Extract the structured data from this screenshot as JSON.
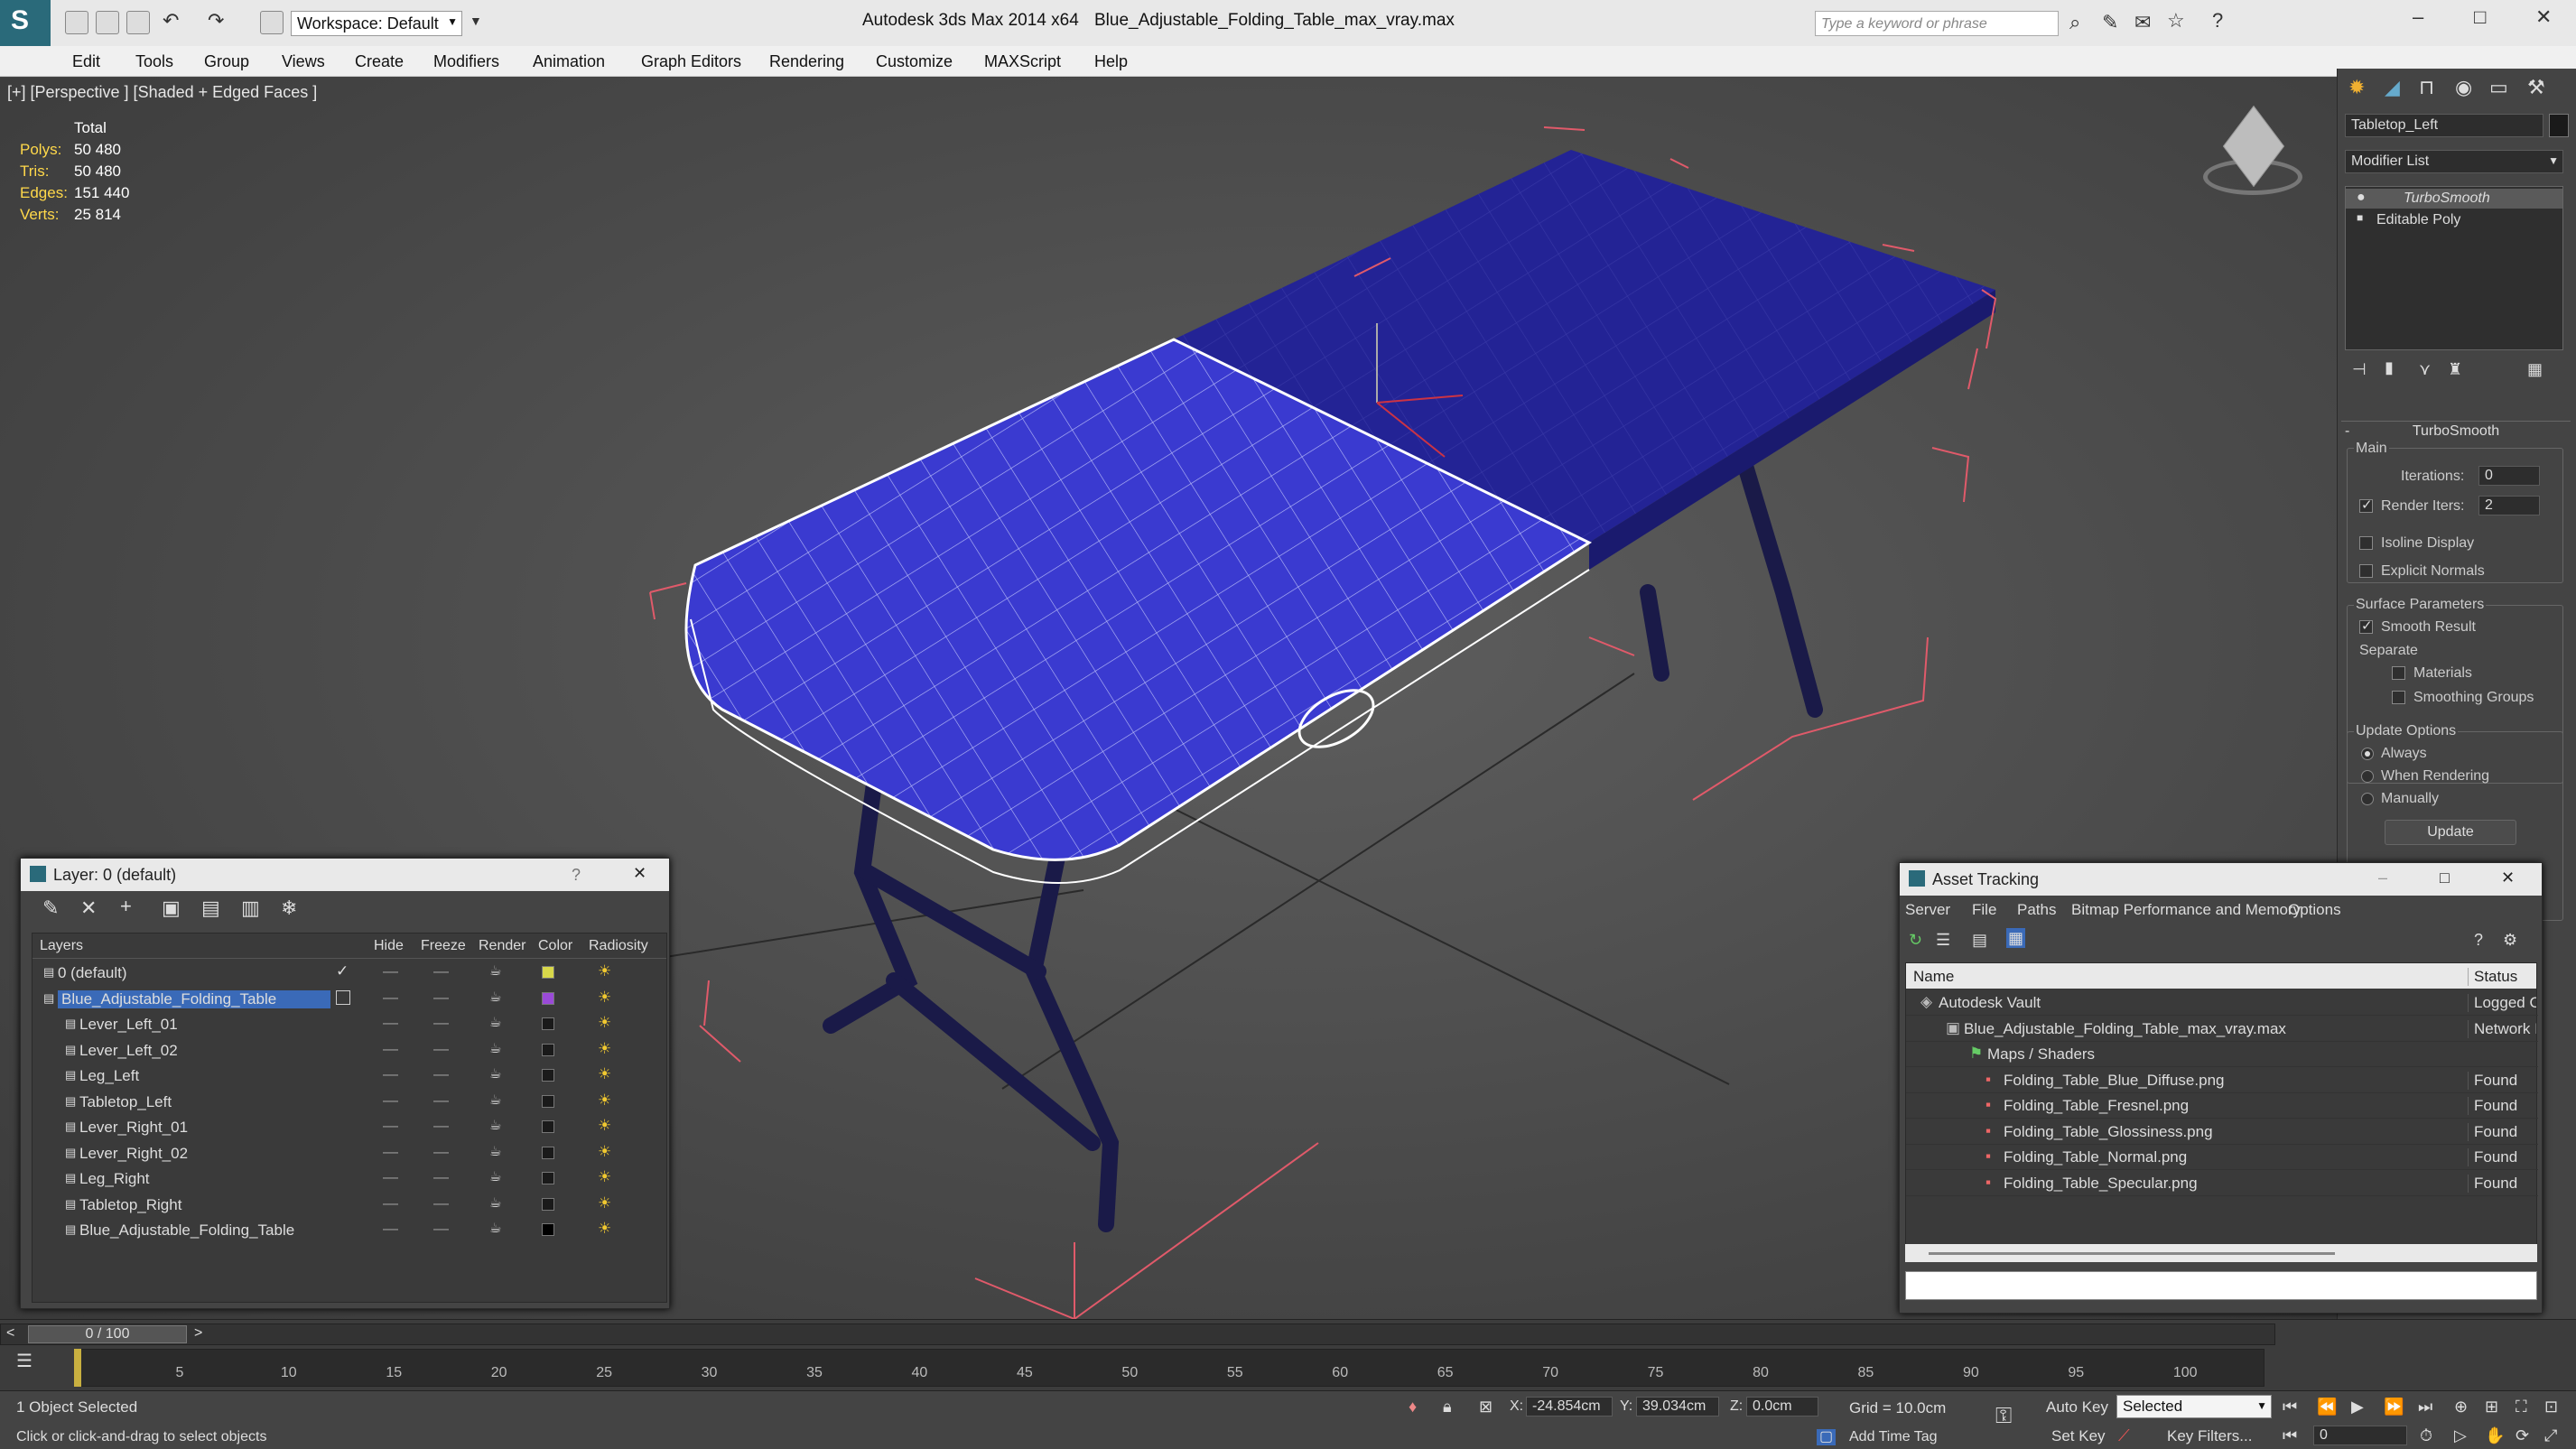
{
  "titlebar": {
    "app": "Autodesk 3ds Max  2014 x64",
    "file": "Blue_Adjustable_Folding_Table_max_vray.max",
    "workspace": "Workspace: Default",
    "search_placeholder": "Type a keyword or phrase"
  },
  "menu": [
    "Edit",
    "Tools",
    "Group",
    "Views",
    "Create",
    "Modifiers",
    "Animation",
    "Graph Editors",
    "Rendering",
    "Customize",
    "MAXScript",
    "Help"
  ],
  "viewport": {
    "label": "[+] [Perspective ] [Shaded + Edged Faces ]",
    "stats": {
      "total_label": "Total",
      "polys_label": "Polys:",
      "polys": "50 480",
      "tris_label": "Tris:",
      "tris": "50 480",
      "edges_label": "Edges:",
      "edges": "151 440",
      "verts_label": "Verts:",
      "verts": "25 814"
    }
  },
  "command_panel": {
    "object_name": "Tabletop_Left",
    "modifier_list": "Modifier List",
    "stack": [
      "TurboSmooth",
      "Editable Poly"
    ],
    "rollout_title": "TurboSmooth",
    "main_label": "Main",
    "iterations_label": "Iterations:",
    "iterations": "0",
    "render_iters_label": "Render Iters:",
    "render_iters": "2",
    "isoline": "Isoline Display",
    "explicit_normals": "Explicit Normals",
    "surface_params": "Surface Parameters",
    "smooth_result": "Smooth Result",
    "separate": "Separate",
    "materials": "Materials",
    "smoothing_groups": "Smoothing Groups",
    "update_options": "Update Options",
    "always": "Always",
    "when_rendering": "When Rendering",
    "manually": "Manually",
    "update_button": "Update"
  },
  "layer_window": {
    "title": "Layer: 0 (default)",
    "help": "?",
    "columns": [
      "Layers",
      "Hide",
      "Freeze",
      "Render",
      "Color",
      "Radiosity"
    ],
    "rows": [
      {
        "name": "0 (default)",
        "color": "#d8d84a"
      },
      {
        "name": "Blue_Adjustable_Folding_Table",
        "color": "#9a4ad8"
      },
      {
        "name": "Lever_Left_01",
        "color": "#1a1a1a"
      },
      {
        "name": "Lever_Left_02",
        "color": "#1a1a1a"
      },
      {
        "name": "Leg_Left",
        "color": "#1a1a1a"
      },
      {
        "name": "Tabletop_Left",
        "color": "#1a1a1a"
      },
      {
        "name": "Lever_Right_01",
        "color": "#1a1a1a"
      },
      {
        "name": "Lever_Right_02",
        "color": "#1a1a1a"
      },
      {
        "name": "Leg_Right",
        "color": "#1a1a1a"
      },
      {
        "name": "Tabletop_Right",
        "color": "#1a1a1a"
      },
      {
        "name": "Blue_Adjustable_Folding_Table",
        "color": "#000000"
      }
    ]
  },
  "asset_window": {
    "title": "Asset Tracking",
    "menu": [
      "Server",
      "File",
      "Paths",
      "Bitmap Performance and Memory",
      "Options"
    ],
    "columns": [
      "Name",
      "Status"
    ],
    "rows": [
      {
        "name": "Autodesk Vault",
        "status": "Logged O"
      },
      {
        "name": "Blue_Adjustable_Folding_Table_max_vray.max",
        "status": "Network I"
      },
      {
        "name": "Maps / Shaders",
        "status": ""
      },
      {
        "name": "Folding_Table_Blue_Diffuse.png",
        "status": "Found"
      },
      {
        "name": "Folding_Table_Fresnel.png",
        "status": "Found"
      },
      {
        "name": "Folding_Table_Glossiness.png",
        "status": "Found"
      },
      {
        "name": "Folding_Table_Normal.png",
        "status": "Found"
      },
      {
        "name": "Folding_Table_Specular.png",
        "status": "Found"
      }
    ]
  },
  "timeline": {
    "frame": "0 / 100",
    "ticks": [
      "5",
      "10",
      "15",
      "20",
      "25",
      "30",
      "35",
      "40",
      "45",
      "50",
      "55",
      "60",
      "65",
      "70",
      "75",
      "80",
      "85",
      "90",
      "95",
      "100"
    ]
  },
  "status": {
    "selected": "1 Object Selected",
    "prompt": "Click or click-and-drag to select objects",
    "x_label": "X:",
    "x": "-24.854cm",
    "y_label": "Y:",
    "y": "39.034cm",
    "z_label": "Z:",
    "z": "0.0cm",
    "grid": "Grid = 10.0cm",
    "auto_key": "Auto Key",
    "selected_dropdown": "Selected",
    "set_key": "Set Key",
    "key_filters": "Key Filters...",
    "add_time_tag": "Add Time Tag",
    "frame_field": "0"
  }
}
